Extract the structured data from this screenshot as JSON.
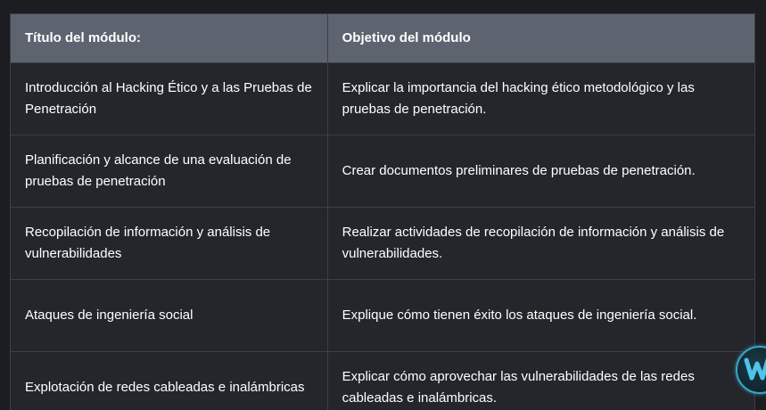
{
  "table": {
    "headers": [
      "Título del módulo:",
      "Objetivo del módulo"
    ],
    "rows": [
      {
        "title": "Introducción al Hacking Ético y a las Pruebas de Penetración",
        "objective": "Explicar la importancia del hacking ético metodológico y las pruebas de penetración."
      },
      {
        "title": "Planificación y alcance de una evaluación de pruebas de penetración",
        "objective": "Crear documentos preliminares de pruebas de penetración."
      },
      {
        "title": "Recopilación de información y análisis de vulnerabilidades",
        "objective": "Realizar actividades de recopilación de información y análisis de vulnerabilidades."
      },
      {
        "title": "Ataques de ingeniería social",
        "objective": "Explique cómo tienen éxito los ataques de ingeniería social."
      },
      {
        "title": "Explotación de redes cableadas e inalámbricas",
        "objective": "Explicar cómo aprovechar las vulnerabilidades de las redes cableadas e inalámbricas."
      }
    ]
  },
  "badge": {
    "icon": "floating-app-badge-icon",
    "accent": "#3aa6c4"
  }
}
